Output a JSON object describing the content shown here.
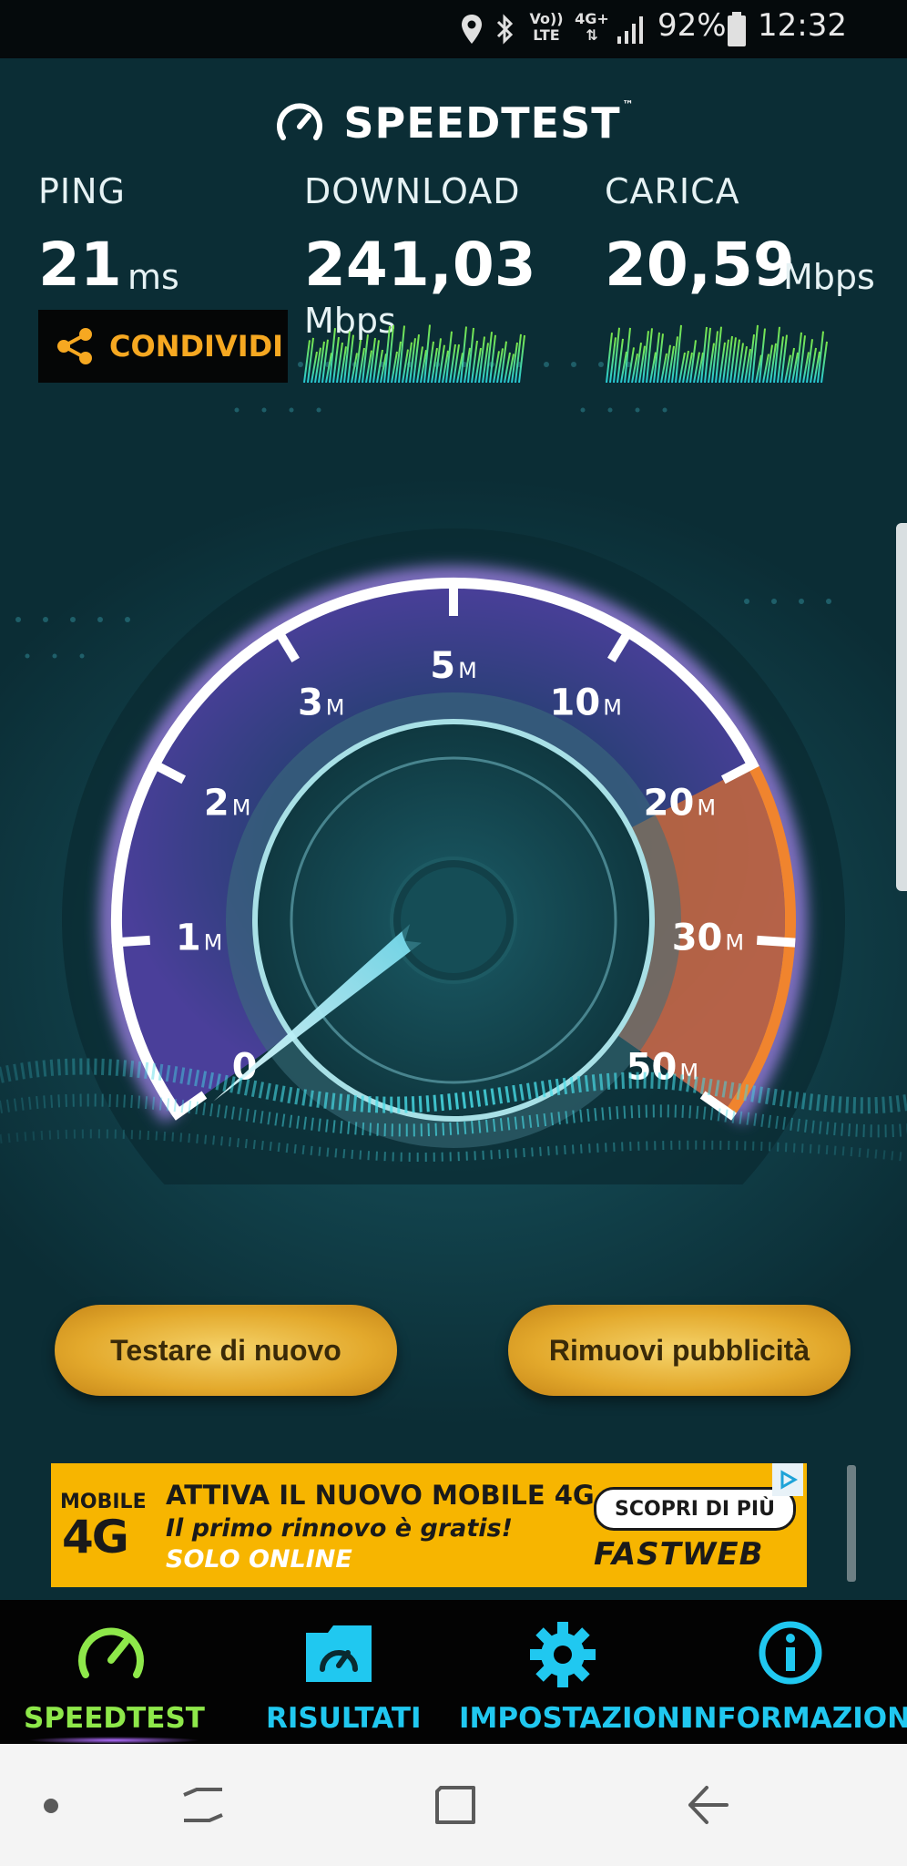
{
  "status_bar": {
    "icons": [
      "location-icon",
      "bluetooth-icon",
      "volte-icon",
      "4g-plus-icon",
      "signal-icon"
    ],
    "volte_top": "Vo))",
    "volte_bottom": "LTE",
    "net_label": "4G+",
    "battery": "92%",
    "time": "12:32"
  },
  "header": {
    "brand": "SPEEDTEST",
    "trademark": "™"
  },
  "metrics": {
    "ping": {
      "label": "PING",
      "value": "21",
      "unit": "ms"
    },
    "download": {
      "label": "DOWNLOAD",
      "value": "241,03",
      "unit": "Mbps"
    },
    "upload": {
      "label": "CARICA",
      "value": "20,59",
      "unit": "Mbps"
    }
  },
  "share_button": {
    "label": "CONDIVIDI",
    "icon": "share-icon"
  },
  "gauge": {
    "ticks": [
      {
        "num": "0",
        "unit": ""
      },
      {
        "num": "1",
        "unit": "M"
      },
      {
        "num": "2",
        "unit": "M"
      },
      {
        "num": "3",
        "unit": "M"
      },
      {
        "num": "5",
        "unit": "M"
      },
      {
        "num": "10",
        "unit": "M"
      },
      {
        "num": "20",
        "unit": "M"
      },
      {
        "num": "30",
        "unit": "M"
      },
      {
        "num": "50",
        "unit": "M"
      }
    ],
    "needle_value": 0,
    "colors": {
      "ring": "#ffffff",
      "glow": "#b98cff",
      "peak": "#f07a2a",
      "needle": "#9ff2ff"
    }
  },
  "buttons": {
    "retest": "Testare di nuovo",
    "remove_ads": "Rimuovi pubblicità"
  },
  "ad": {
    "badge_top": "MOBILE",
    "badge_bottom": "4G",
    "headline": "ATTIVA IL NUOVO MOBILE 4G",
    "subline": "Il primo rinnovo è gratis!",
    "tagline": "SOLO ONLINE",
    "cta": "SCOPRI DI PIÙ",
    "brand": "FASTWEB",
    "background": "#f7b500"
  },
  "tabs": [
    {
      "label": "SPEEDTEST",
      "icon": "speedometer-icon",
      "active": true,
      "color": "#8ee84a"
    },
    {
      "label": "RISULTATI",
      "icon": "results-folder-icon",
      "active": false,
      "color": "#20c8f0"
    },
    {
      "label": "IMPOSTAZIONI",
      "icon": "gear-icon",
      "active": false,
      "color": "#20c8f0"
    },
    {
      "label": "INFORMAZIONI",
      "icon": "info-icon",
      "active": false,
      "color": "#20c8f0"
    }
  ],
  "nav": {
    "icons": [
      "dot-icon",
      "recents-icon",
      "home-icon",
      "back-icon"
    ]
  }
}
